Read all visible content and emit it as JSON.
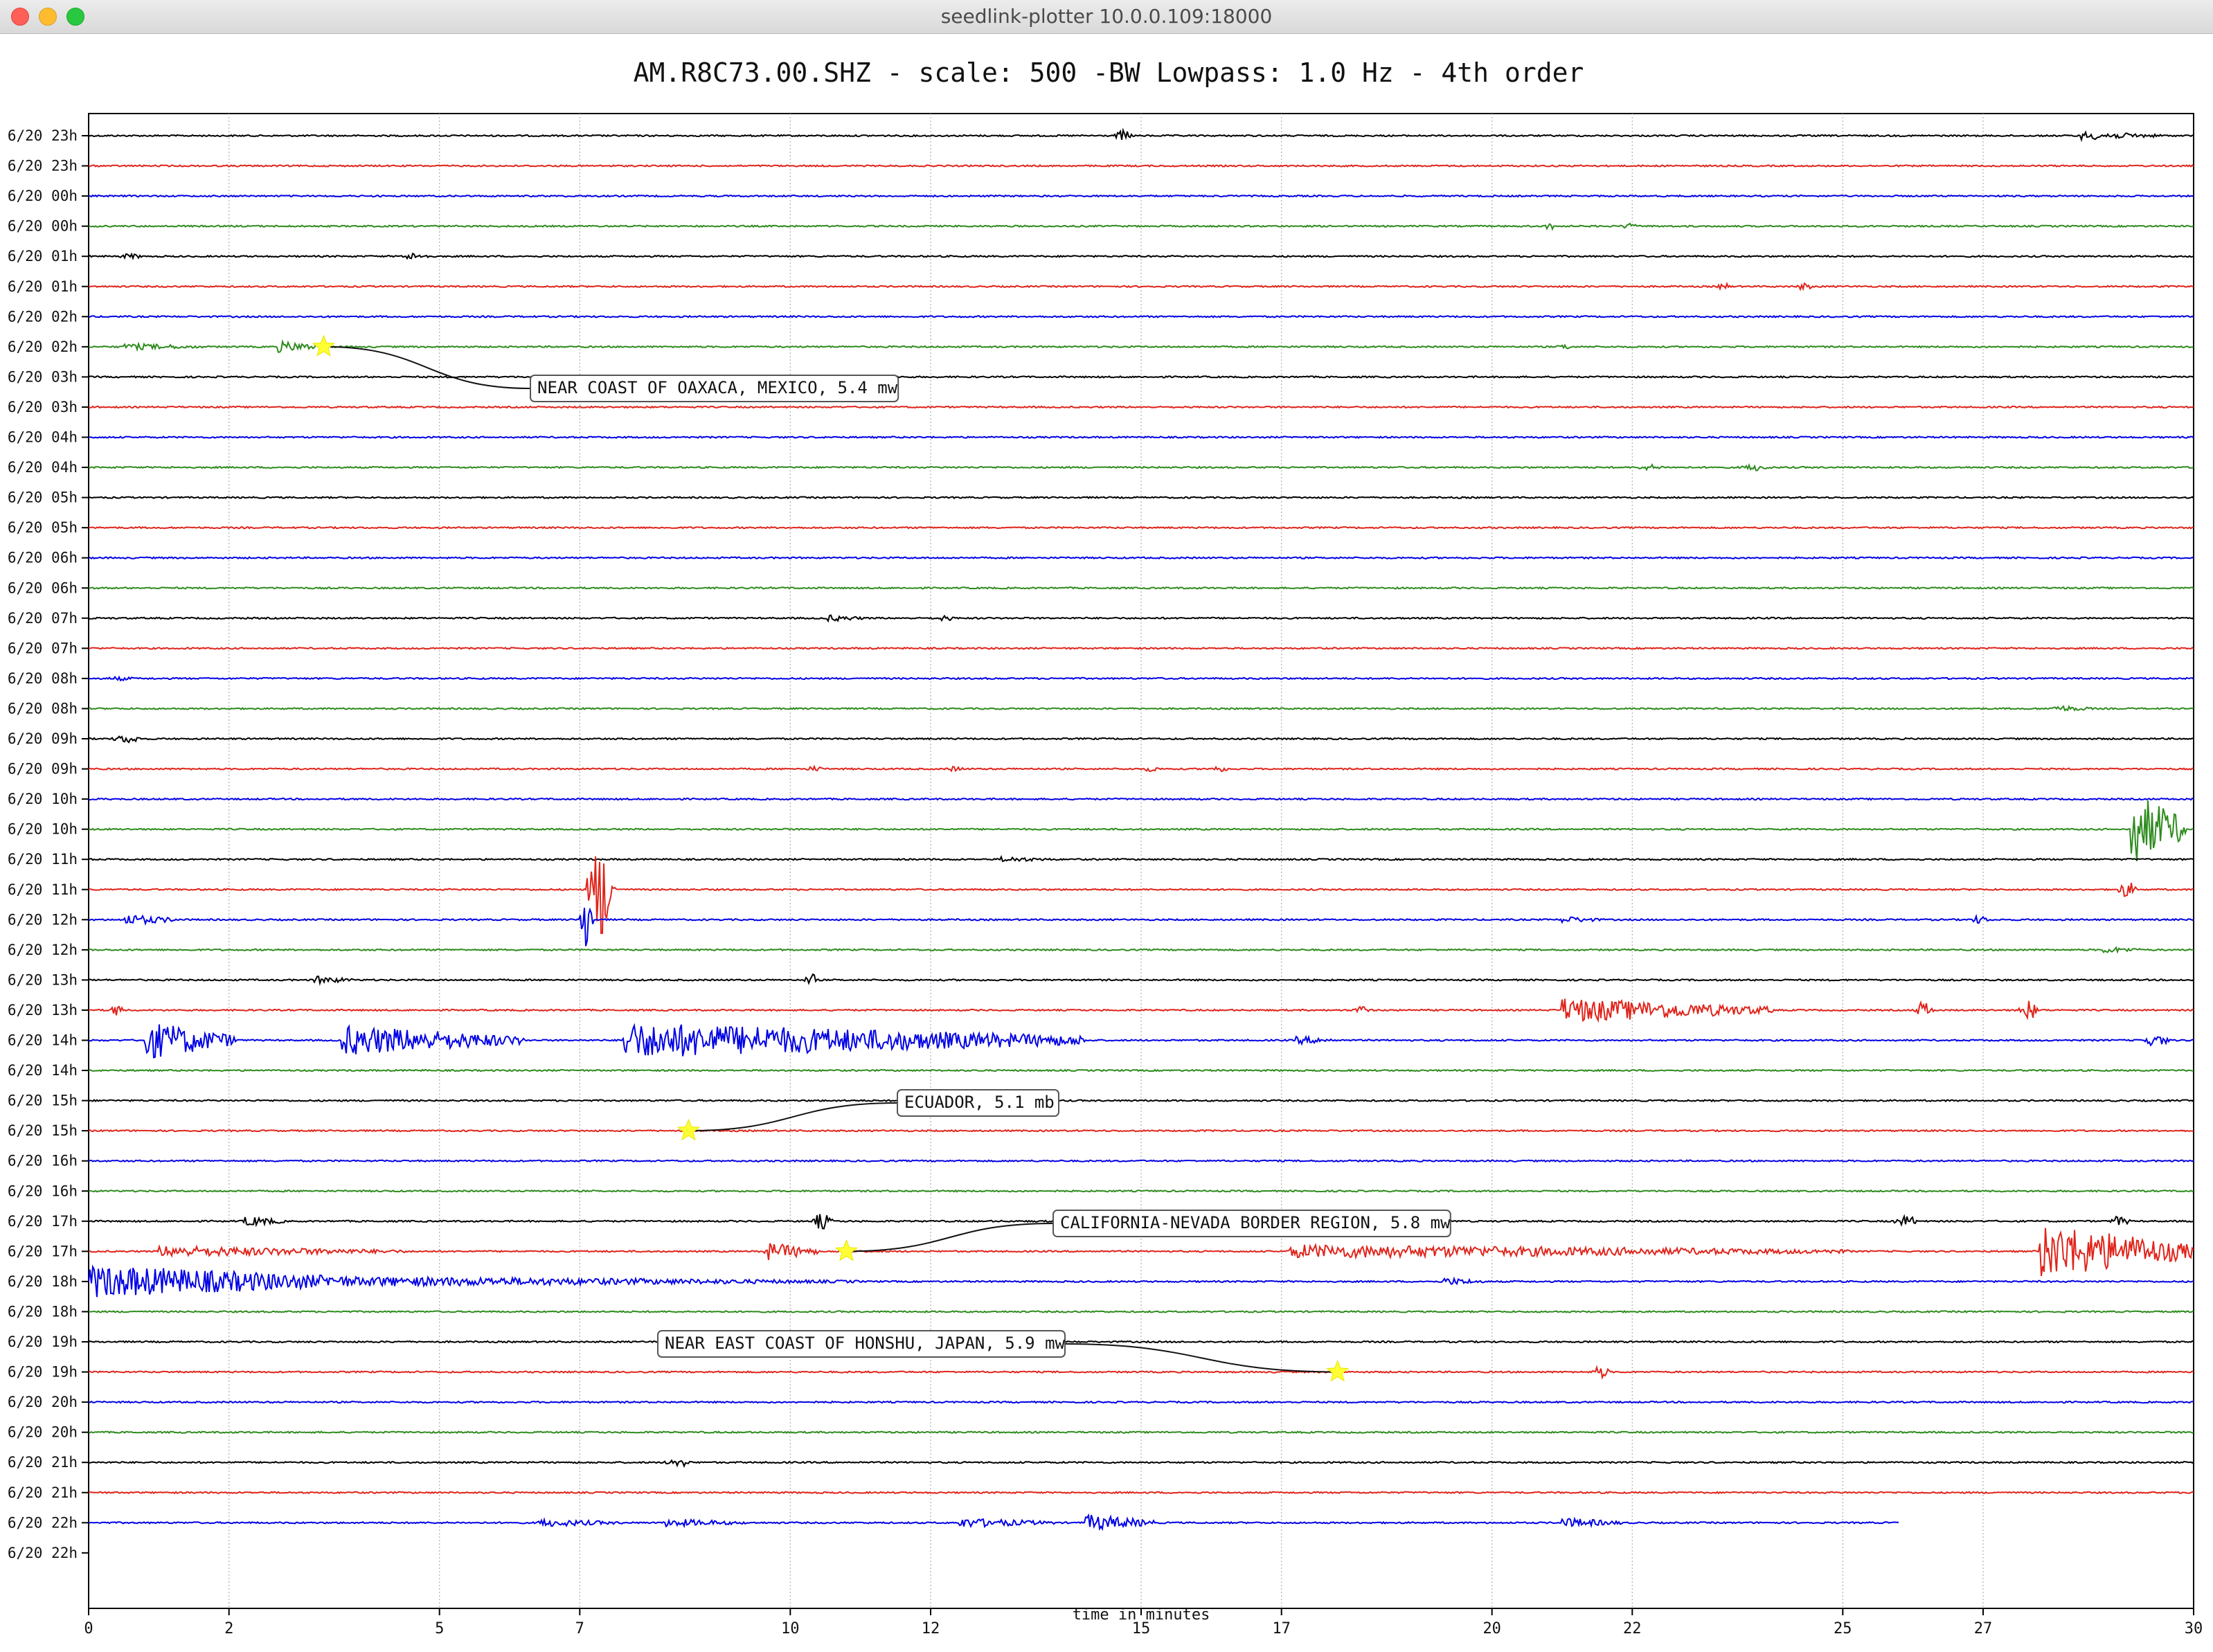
{
  "window": {
    "title": "seedlink-plotter 10.0.0.109:18000"
  },
  "chart_data": {
    "type": "line",
    "title": "AM.R8C73.00.SHZ - scale: 500 -BW Lowpass: 1.0 Hz - 4th order",
    "xlabel": "time in minutes",
    "ylabel": "",
    "xlim": [
      0,
      30
    ],
    "xticks": [
      0,
      2,
      5,
      7,
      10,
      12,
      15,
      17,
      20,
      22,
      25,
      27,
      30
    ],
    "grid": "vertical",
    "trace_colors": [
      "#000000",
      "#e0241b",
      "#0000e6",
      "#2e8b1e"
    ],
    "row_labels": [
      "6/20 23h",
      "6/20 23h",
      "6/20 00h",
      "6/20 00h",
      "6/20 01h",
      "6/20 01h",
      "6/20 02h",
      "6/20 02h",
      "6/20 03h",
      "6/20 03h",
      "6/20 04h",
      "6/20 04h",
      "6/20 05h",
      "6/20 05h",
      "6/20 06h",
      "6/20 06h",
      "6/20 07h",
      "6/20 07h",
      "6/20 08h",
      "6/20 08h",
      "6/20 09h",
      "6/20 09h",
      "6/20 10h",
      "6/20 10h",
      "6/20 11h",
      "6/20 11h",
      "6/20 12h",
      "6/20 12h",
      "6/20 13h",
      "6/20 13h",
      "6/20 14h",
      "6/20 14h",
      "6/20 15h",
      "6/20 15h",
      "6/20 16h",
      "6/20 16h",
      "6/20 17h",
      "6/20 17h",
      "6/20 18h",
      "6/20 18h",
      "6/20 19h",
      "6/20 19h",
      "6/20 20h",
      "6/20 20h",
      "6/20 21h",
      "6/20 21h",
      "6/20 22h",
      "6/20 22h"
    ],
    "trace_end_minutes": {
      "46": 25.8,
      "47": 0
    },
    "events": [
      {
        "row": 7,
        "minute": 3.35,
        "label": "NEAR COAST OF OAXACA, MEXICO, 5.4 mw"
      },
      {
        "row": 33,
        "minute": 8.55,
        "label": "ECUADOR, 5.1 mb"
      },
      {
        "row": 37,
        "minute": 10.8,
        "label": "CALIFORNIA-NEVADA BORDER REGION, 5.8 mw"
      },
      {
        "row": 41,
        "minute": 17.8,
        "label": "NEAR EAST COAST OF HONSHU, JAPAN, 5.9 mw"
      }
    ],
    "activity": [
      {
        "row": 0,
        "minute": 14.6,
        "amplitude": 8,
        "duration": 0.3
      },
      {
        "row": 0,
        "minute": 28.4,
        "amplitude": 6,
        "duration": 1.2
      },
      {
        "row": 3,
        "minute": 20.7,
        "amplitude": 5,
        "duration": 0.3
      },
      {
        "row": 3,
        "minute": 21.8,
        "amplitude": 4,
        "duration": 0.3
      },
      {
        "row": 4,
        "minute": 0.4,
        "amplitude": 4,
        "duration": 0.4
      },
      {
        "row": 4,
        "minute": 4.4,
        "amplitude": 5,
        "duration": 0.5
      },
      {
        "row": 5,
        "minute": 23.2,
        "amplitude": 6,
        "duration": 0.2
      },
      {
        "row": 5,
        "minute": 24.3,
        "amplitude": 5,
        "duration": 0.3
      },
      {
        "row": 7,
        "minute": 0.5,
        "amplitude": 5,
        "duration": 1.2
      },
      {
        "row": 7,
        "minute": 2.7,
        "amplitude": 8,
        "duration": 0.7
      },
      {
        "row": 7,
        "minute": 20.9,
        "amplitude": 4,
        "duration": 0.3
      },
      {
        "row": 11,
        "minute": 22.0,
        "amplitude": 4,
        "duration": 0.5
      },
      {
        "row": 11,
        "minute": 23.5,
        "amplitude": 5,
        "duration": 0.5
      },
      {
        "row": 16,
        "minute": 10.5,
        "amplitude": 5,
        "duration": 0.6
      },
      {
        "row": 16,
        "minute": 12.0,
        "amplitude": 4,
        "duration": 0.4
      },
      {
        "row": 18,
        "minute": 0.2,
        "amplitude": 3,
        "duration": 0.5
      },
      {
        "row": 19,
        "minute": 28.0,
        "amplitude": 5,
        "duration": 0.6
      },
      {
        "row": 20,
        "minute": 0.3,
        "amplitude": 6,
        "duration": 0.5
      },
      {
        "row": 21,
        "minute": 10.2,
        "amplitude": 4,
        "duration": 0.3
      },
      {
        "row": 21,
        "minute": 12.2,
        "amplitude": 4,
        "duration": 0.3
      },
      {
        "row": 21,
        "minute": 15.0,
        "amplitude": 4,
        "duration": 0.3
      },
      {
        "row": 21,
        "minute": 15.9,
        "amplitude": 4,
        "duration": 0.4
      },
      {
        "row": 24,
        "minute": 13.0,
        "amplitude": 4,
        "duration": 0.8
      },
      {
        "row": 25,
        "minute": 7.1,
        "amplitude": 70,
        "duration": 0.4
      },
      {
        "row": 25,
        "minute": 28.9,
        "amplitude": 12,
        "duration": 0.3
      },
      {
        "row": 26,
        "minute": 0.5,
        "amplitude": 8,
        "duration": 0.8
      },
      {
        "row": 26,
        "minute": 7.0,
        "amplitude": 50,
        "duration": 0.2
      },
      {
        "row": 26,
        "minute": 21.0,
        "amplitude": 5,
        "duration": 0.6
      },
      {
        "row": 26,
        "minute": 26.8,
        "amplitude": 6,
        "duration": 0.3
      },
      {
        "row": 27,
        "minute": 28.7,
        "amplitude": 5,
        "duration": 0.6
      },
      {
        "row": 23,
        "minute": 29.1,
        "amplitude": 55,
        "duration": 0.8
      },
      {
        "row": 28,
        "minute": 3.2,
        "amplitude": 6,
        "duration": 0.6
      },
      {
        "row": 28,
        "minute": 10.2,
        "amplitude": 10,
        "duration": 0.2
      },
      {
        "row": 29,
        "minute": 0.3,
        "amplitude": 10,
        "duration": 0.2
      },
      {
        "row": 29,
        "minute": 18.0,
        "amplitude": 6,
        "duration": 0.3
      },
      {
        "row": 29,
        "minute": 21.0,
        "amplitude": 18,
        "duration": 3.0
      },
      {
        "row": 29,
        "minute": 26.0,
        "amplitude": 12,
        "duration": 0.3
      },
      {
        "row": 29,
        "minute": 27.5,
        "amplitude": 14,
        "duration": 0.3
      },
      {
        "row": 30,
        "minute": 0.8,
        "amplitude": 28,
        "duration": 1.3
      },
      {
        "row": 30,
        "minute": 3.6,
        "amplitude": 22,
        "duration": 2.6
      },
      {
        "row": 30,
        "minute": 7.6,
        "amplitude": 26,
        "duration": 6.6
      },
      {
        "row": 30,
        "minute": 17.2,
        "amplitude": 6,
        "duration": 0.6
      },
      {
        "row": 30,
        "minute": 29.2,
        "amplitude": 8,
        "duration": 0.5
      },
      {
        "row": 37,
        "minute": 1.0,
        "amplitude": 8,
        "duration": 3.5
      },
      {
        "row": 37,
        "minute": 9.6,
        "amplitude": 14,
        "duration": 0.8
      },
      {
        "row": 37,
        "minute": 17.1,
        "amplitude": 10,
        "duration": 8.0
      },
      {
        "row": 37,
        "minute": 27.8,
        "amplitude": 40,
        "duration": 2.2
      },
      {
        "row": 36,
        "minute": 2.2,
        "amplitude": 8,
        "duration": 0.6
      },
      {
        "row": 36,
        "minute": 10.3,
        "amplitude": 12,
        "duration": 0.3
      },
      {
        "row": 36,
        "minute": 25.7,
        "amplitude": 8,
        "duration": 0.4
      },
      {
        "row": 36,
        "minute": 28.8,
        "amplitude": 8,
        "duration": 0.3
      },
      {
        "row": 38,
        "minute": 0.0,
        "amplitude": 24,
        "duration": 4.0
      },
      {
        "row": 38,
        "minute": 4.0,
        "amplitude": 7,
        "duration": 7.0
      },
      {
        "row": 38,
        "minute": 19.3,
        "amplitude": 6,
        "duration": 0.6
      },
      {
        "row": 41,
        "minute": 21.4,
        "amplitude": 9,
        "duration": 0.3
      },
      {
        "row": 44,
        "minute": 8.2,
        "amplitude": 7,
        "duration": 0.4
      },
      {
        "row": 46,
        "minute": 6.4,
        "amplitude": 6,
        "duration": 1.2
      },
      {
        "row": 46,
        "minute": 8.2,
        "amplitude": 6,
        "duration": 1.2
      },
      {
        "row": 46,
        "minute": 12.4,
        "amplitude": 7,
        "duration": 1.4
      },
      {
        "row": 46,
        "minute": 14.2,
        "amplitude": 12,
        "duration": 1.0
      },
      {
        "row": 46,
        "minute": 21.0,
        "amplitude": 7,
        "duration": 0.9
      }
    ]
  }
}
